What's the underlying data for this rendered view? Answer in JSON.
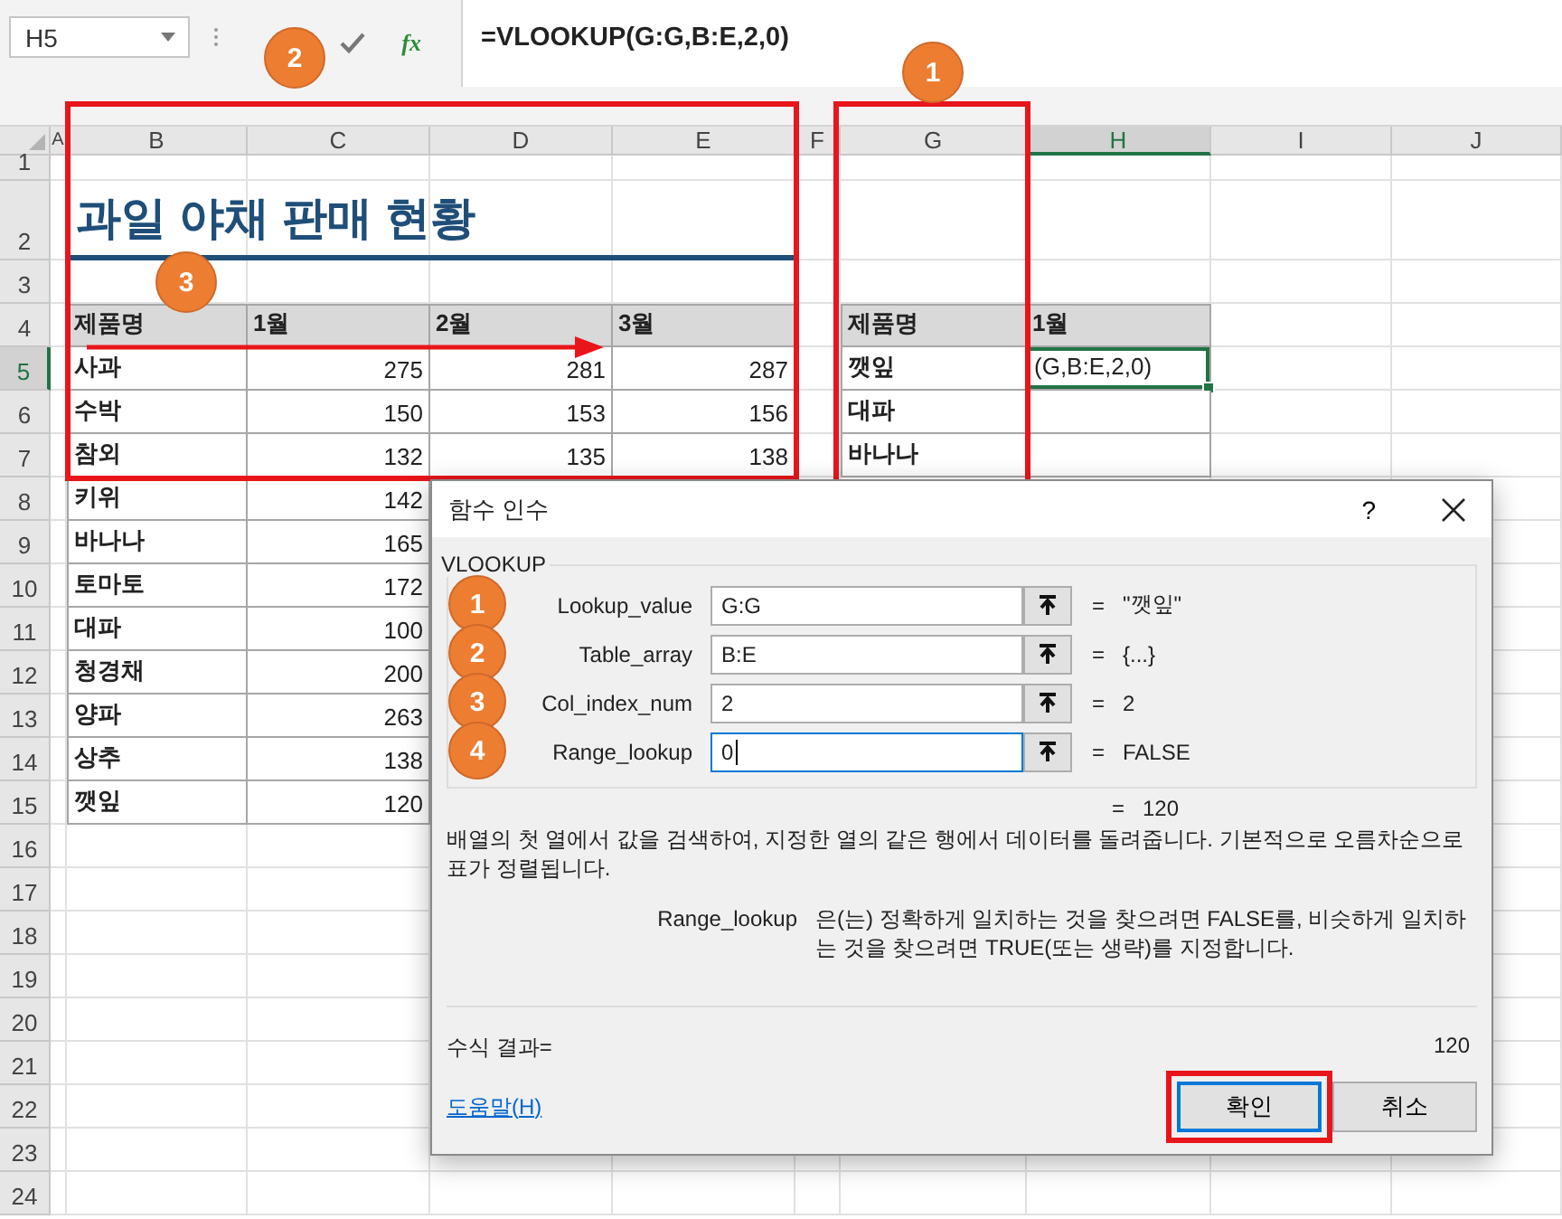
{
  "formula_bar": {
    "name_box": "H5",
    "function_button": "fx",
    "formula": "=VLOOKUP(G:G,B:E,2,0)",
    "callout": "2"
  },
  "column_headers": [
    {
      "label": "A",
      "selected": false
    },
    {
      "label": "B",
      "selected": false
    },
    {
      "label": "C",
      "selected": false
    },
    {
      "label": "D",
      "selected": false
    },
    {
      "label": "E",
      "selected": false
    },
    {
      "label": "F",
      "selected": false
    },
    {
      "label": "G",
      "selected": false
    },
    {
      "label": "H",
      "selected": true
    },
    {
      "label": "I",
      "selected": false
    },
    {
      "label": "J",
      "selected": false
    }
  ],
  "row_headers": [
    {
      "label": "1",
      "selected": false
    },
    {
      "label": "2",
      "selected": false
    },
    {
      "label": "3",
      "selected": false
    },
    {
      "label": "4",
      "selected": false
    },
    {
      "label": "5",
      "selected": true
    },
    {
      "label": "6",
      "selected": false
    },
    {
      "label": "7",
      "selected": false
    },
    {
      "label": "8",
      "selected": false
    },
    {
      "label": "9",
      "selected": false
    },
    {
      "label": "10",
      "selected": false
    },
    {
      "label": "11",
      "selected": false
    },
    {
      "label": "12",
      "selected": false
    },
    {
      "label": "13",
      "selected": false
    },
    {
      "label": "14",
      "selected": false
    },
    {
      "label": "15",
      "selected": false
    },
    {
      "label": "16",
      "selected": false
    },
    {
      "label": "17",
      "selected": false
    },
    {
      "label": "18",
      "selected": false
    },
    {
      "label": "19",
      "selected": false
    },
    {
      "label": "20",
      "selected": false
    },
    {
      "label": "21",
      "selected": false
    },
    {
      "label": "22",
      "selected": false
    },
    {
      "label": "23",
      "selected": false
    },
    {
      "label": "24",
      "selected": false
    }
  ],
  "sheet": {
    "title": "과일 야채 판매 현황",
    "sales_table": {
      "callout": "3",
      "columns": [
        "제품명",
        "1월",
        "2월",
        "3월"
      ],
      "rows": [
        [
          "사과",
          "275",
          "281",
          "287"
        ],
        [
          "수박",
          "150",
          "153",
          "156"
        ],
        [
          "참외",
          "132",
          "135",
          "138"
        ],
        [
          "키위",
          "142"
        ],
        [
          "바나나",
          "165"
        ],
        [
          "토마토",
          "172"
        ],
        [
          "대파",
          "100"
        ],
        [
          "청경채",
          "200"
        ],
        [
          "양파",
          "263"
        ],
        [
          "상추",
          "138"
        ],
        [
          "깻잎",
          "120"
        ]
      ]
    },
    "lookup_table": {
      "callout": "1",
      "columns": [
        "제품명",
        "1월"
      ],
      "rows": [
        {
          "name": "깻잎",
          "value": "(G,B:E,2,0)",
          "selected": true
        },
        {
          "name": "대파",
          "selected": false
        },
        {
          "name": "바나나",
          "selected": false
        }
      ]
    }
  },
  "dialog": {
    "title": "함수 인수",
    "help_glyph": "?",
    "function_name": "VLOOKUP",
    "arguments": [
      {
        "callout": "1",
        "name": "Lookup_value",
        "value": "G:G",
        "equals": "=",
        "result": "\"깻잎\"",
        "focused": false
      },
      {
        "callout": "2",
        "name": "Table_array",
        "value": "B:E",
        "equals": "=",
        "result": "{...}",
        "focused": false
      },
      {
        "callout": "3",
        "name": "Col_index_num",
        "value": "2",
        "equals": "=",
        "result": "2",
        "focused": false
      },
      {
        "callout": "4",
        "name": "Range_lookup",
        "value": "0",
        "equals": "=",
        "result": "FALSE",
        "focused": true
      }
    ],
    "result": {
      "equals": "=",
      "value": "120"
    },
    "description": "배열의 첫 열에서 값을 검색하여, 지정한 열의 같은 행에서 데이터를 돌려줍니다. 기본적으로 오름차순으로 표가 정렬됩니다.",
    "argument_help": {
      "name": "Range_lookup",
      "text": "은(는) 정확하게 일치하는 것을 찾으려면 FALSE를, 비슷하게 일치하는 것을 찾으려면 TRUE(또는 생략)를 지정합니다."
    },
    "formula_result": {
      "label": "수식 결과=",
      "value": "120"
    },
    "help_link": "도움말(H)",
    "buttons": [
      {
        "label": "확인",
        "default": true,
        "highlighted": true
      },
      {
        "label": "취소",
        "default": false,
        "highlighted": false
      }
    ]
  }
}
